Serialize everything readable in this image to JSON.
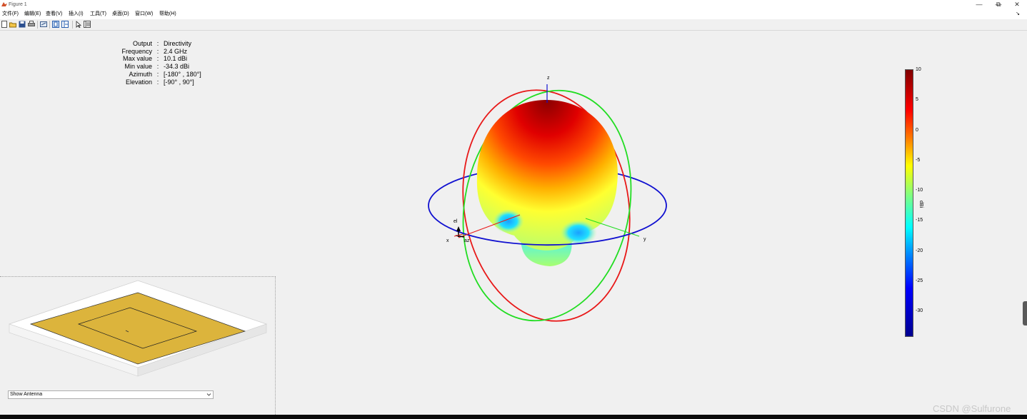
{
  "window": {
    "title": "Figure 1",
    "controls": {
      "minimize": "—",
      "restore": "⧉",
      "close": "✕"
    }
  },
  "menu": {
    "items": [
      "文件(F)",
      "编辑(E)",
      "查看(V)",
      "插入(I)",
      "工具(T)",
      "桌面(D)",
      "窗口(W)",
      "帮助(H)"
    ],
    "right_arrow": "↘"
  },
  "toolbar": {
    "icons": [
      "new-figure-icon",
      "open-file-icon",
      "save-icon",
      "print-icon",
      "link-plot-icon",
      "hide-plot-tools-icon",
      "show-plot-tools-icon",
      "edit-plot-icon",
      "property-inspector-icon"
    ]
  },
  "info": {
    "rows": [
      {
        "label": "Output",
        "value": "Directivity"
      },
      {
        "label": "Frequency",
        "value": "2.4 GHz"
      },
      {
        "label": "Max value",
        "value": "10.1 dBi"
      },
      {
        "label": "Min value",
        "value": "-34.3 dBi"
      },
      {
        "label": "Azimuth",
        "value": "[-180° , 180°]"
      },
      {
        "label": "Elevation",
        "value": "[-90° , 90°]"
      }
    ]
  },
  "plot": {
    "axis_labels": {
      "z": "z",
      "x": "x",
      "y": "y",
      "el": "el",
      "az": "az"
    },
    "ring_colors": {
      "azimuth": "#1010d0",
      "elevation_a": "#e81818",
      "elevation_b": "#22dd22"
    }
  },
  "colorbar": {
    "ticks": [
      "10",
      "5",
      "0",
      "-5",
      "-10",
      "-15",
      "-20",
      "-25",
      "-30"
    ],
    "unit": "dBi",
    "range": [
      -34.3,
      10.1
    ]
  },
  "preview": {
    "dropdown_value": "Show Antenna",
    "patch_color": "#dcb43c"
  },
  "watermark": "CSDN @Sulfurone"
}
